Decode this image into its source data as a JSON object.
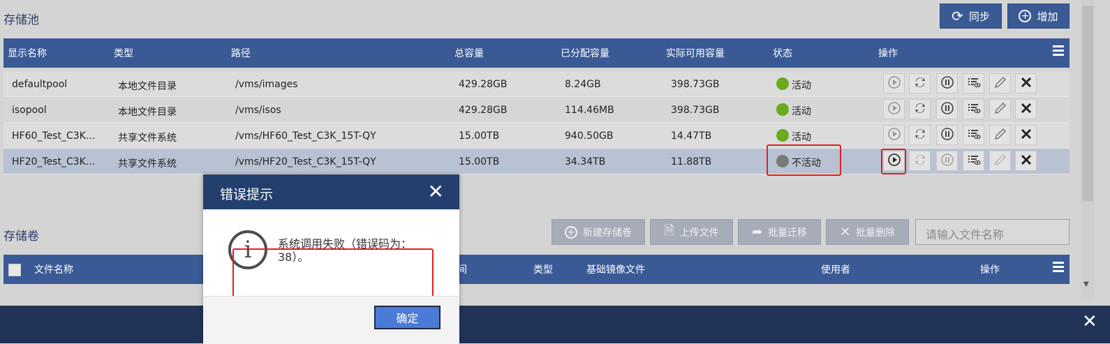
{
  "pool_section": {
    "title": "存储池",
    "sync_label": "同步",
    "add_label": "增加",
    "columns": [
      "显示名称",
      "类型",
      "路径",
      "总容量",
      "已分配容量",
      "实际可用容量",
      "状态",
      "操作"
    ],
    "rows": [
      {
        "name": "defaultpool",
        "type": "本地文件目录",
        "path": "/vms/images",
        "total": "429.28GB",
        "allocated": "8.24GB",
        "available": "398.73GB",
        "status": "活动",
        "status_color": "#6aaa1e"
      },
      {
        "name": "isopool",
        "type": "本地文件目录",
        "path": "/vms/isos",
        "total": "429.28GB",
        "allocated": "114.46MB",
        "available": "398.73GB",
        "status": "活动",
        "status_color": "#6aaa1e"
      },
      {
        "name": "HF60_Test_C3K...",
        "type": "共享文件系统",
        "path": "/vms/HF60_Test_C3K_15T-QY",
        "total": "15.00TB",
        "allocated": "940.50GB",
        "available": "14.47TB",
        "status": "活动",
        "status_color": "#6aaa1e"
      },
      {
        "name": "HF20_Test_C3K...",
        "type": "共享文件系统",
        "path": "/vms/HF20_Test_C3K_15T-QY",
        "total": "15.00TB",
        "allocated": "34.34TB",
        "available": "11.88TB",
        "status": "不活动",
        "status_color": "#7a7a7a"
      }
    ],
    "op_icons": [
      "play-icon",
      "refresh-icon",
      "pause-icon",
      "details-icon",
      "edit-icon",
      "delete-icon"
    ]
  },
  "volume_section": {
    "title": "存储卷",
    "new_volume_label": "新建存储卷",
    "upload_label": "上传文件",
    "migrate_label": "批量迁移",
    "batch_delete_label": "批量删除",
    "search_placeholder": "请输入文件名称",
    "columns": [
      "文件名称",
      "间",
      "类型",
      "基础镜像文件",
      "使用者",
      "操作"
    ]
  },
  "dialog": {
    "title": "错误提示",
    "close": "✕",
    "message": "系统调用失败（错误码为：38）。",
    "ok_label": "确定"
  },
  "bottom_bar": {
    "close": "✕"
  }
}
